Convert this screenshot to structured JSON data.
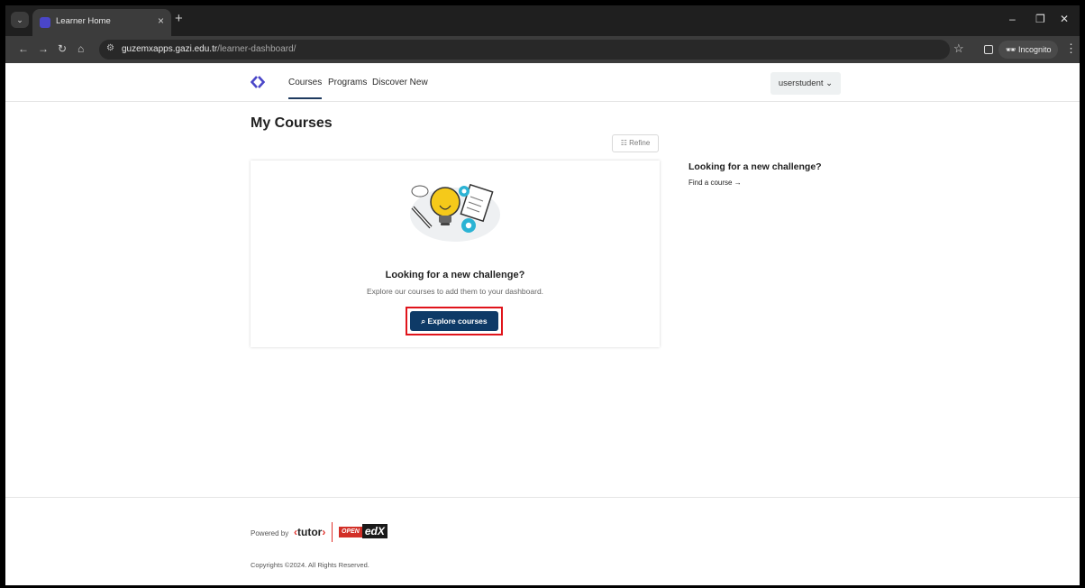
{
  "browser": {
    "tab_title": "Learner Home",
    "tab_close": "×",
    "new_tab": "+",
    "url_host": "guzemxapps.gazi.edu.tr",
    "url_path": "/learner-dashboard/",
    "incognito_label": "Incognito",
    "window_controls": [
      "–",
      "❐",
      "✕"
    ]
  },
  "header": {
    "nav": [
      "Courses",
      "Programs",
      "Discover New"
    ],
    "user_label": "userstudent"
  },
  "main": {
    "title": "My Courses",
    "refine_label": "Refine",
    "empty_card": {
      "title": "Looking for a new challenge?",
      "subtitle": "Explore our courses to add them to your dashboard.",
      "button_label": "Explore courses"
    },
    "sidebar": {
      "title": "Looking for a new challenge?",
      "link_label": "Find a course"
    }
  },
  "footer": {
    "powered_by": "Powered by",
    "tutor_text": "tutor",
    "openedx_open": "OPEN",
    "openedx_edx": "edX",
    "copyright": "Copyrights ©2024. All Rights Reserved."
  },
  "colors": {
    "brand_primary": "#0e3a67",
    "highlight_red": "#e0141b",
    "logo_purple": "#4a46c8"
  }
}
